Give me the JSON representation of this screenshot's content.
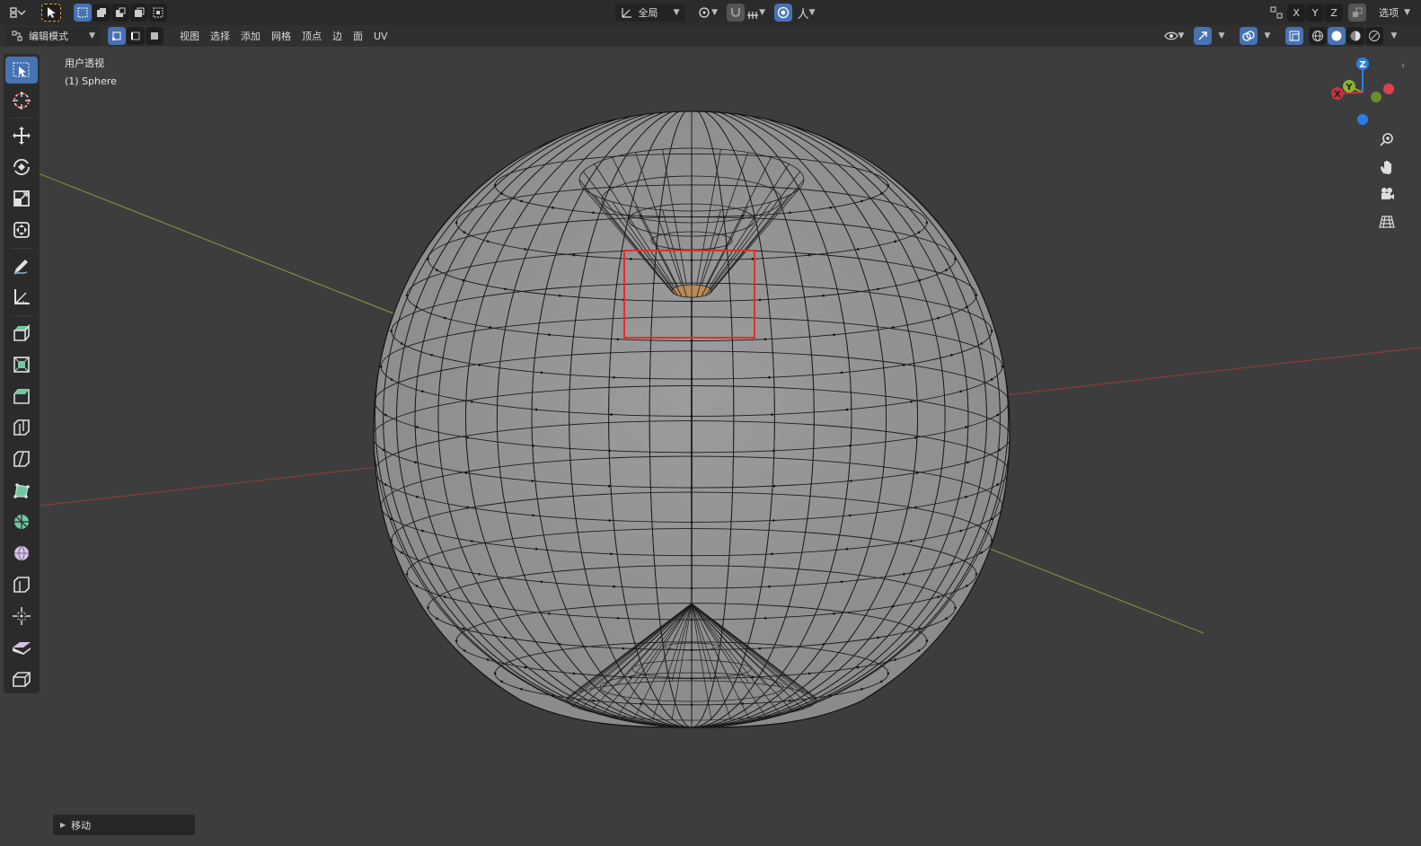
{
  "header": {
    "mode_dropdown": "编辑模式",
    "menus": [
      "视图",
      "选择",
      "添加",
      "网格",
      "顶点",
      "边",
      "面",
      "UV"
    ],
    "transform_orientation": "全局",
    "axis_labels": [
      "X",
      "Y",
      "Z"
    ],
    "options_label": "选项",
    "pivot_symbol": "人"
  },
  "viewport": {
    "view_name": "用户透视",
    "object_name": "(1) Sphere",
    "gizmo_axes": {
      "x": "X",
      "y": "Y",
      "z": "Z"
    },
    "colors": {
      "x_axis": "#c9303e",
      "y_axis": "#8bb330",
      "z_axis": "#2f7de1",
      "selection_box": "#e32d2d",
      "active_tool": "#4772b3"
    }
  },
  "toolbar": {
    "tools": [
      "select-box-icon",
      "cursor-icon",
      "move-icon",
      "rotate-icon",
      "scale-icon",
      "transform-icon",
      "annotate-icon",
      "measure-icon",
      "extrude-icon",
      "inset-icon",
      "bevel-icon",
      "loop-cut-icon",
      "knife-icon",
      "poly-build-icon",
      "spin-icon",
      "smooth-icon",
      "edge-slide-icon",
      "shrink-fatten-icon",
      "shear-icon",
      "rip-icon"
    ]
  },
  "last_operation": {
    "label": "移动"
  }
}
